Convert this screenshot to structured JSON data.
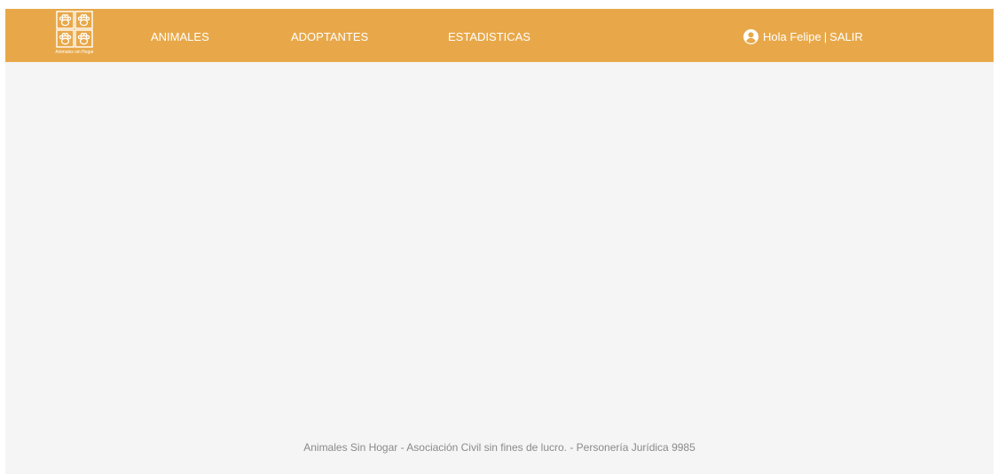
{
  "colors": {
    "navbar_bg": "#e8a849",
    "page_bg": "#f5f5f5",
    "nav_text": "#ffffff",
    "footer_text": "#8a8a8a"
  },
  "logo": {
    "icon": "paw-print-grid-icon",
    "caption": "Animales sin Hogar"
  },
  "nav": {
    "animales": "ANIMALES",
    "adoptantes": "ADOPTANTES",
    "estadisticas": "ESTADISTICAS"
  },
  "user": {
    "icon": "user-circle-icon",
    "greeting": "Hola Felipe",
    "separator": "|",
    "logout": "SALIR"
  },
  "footer": {
    "text": "Animales Sin Hogar - Asociación Civil sin fines de lucro. - Personería Jurídica 9985"
  }
}
